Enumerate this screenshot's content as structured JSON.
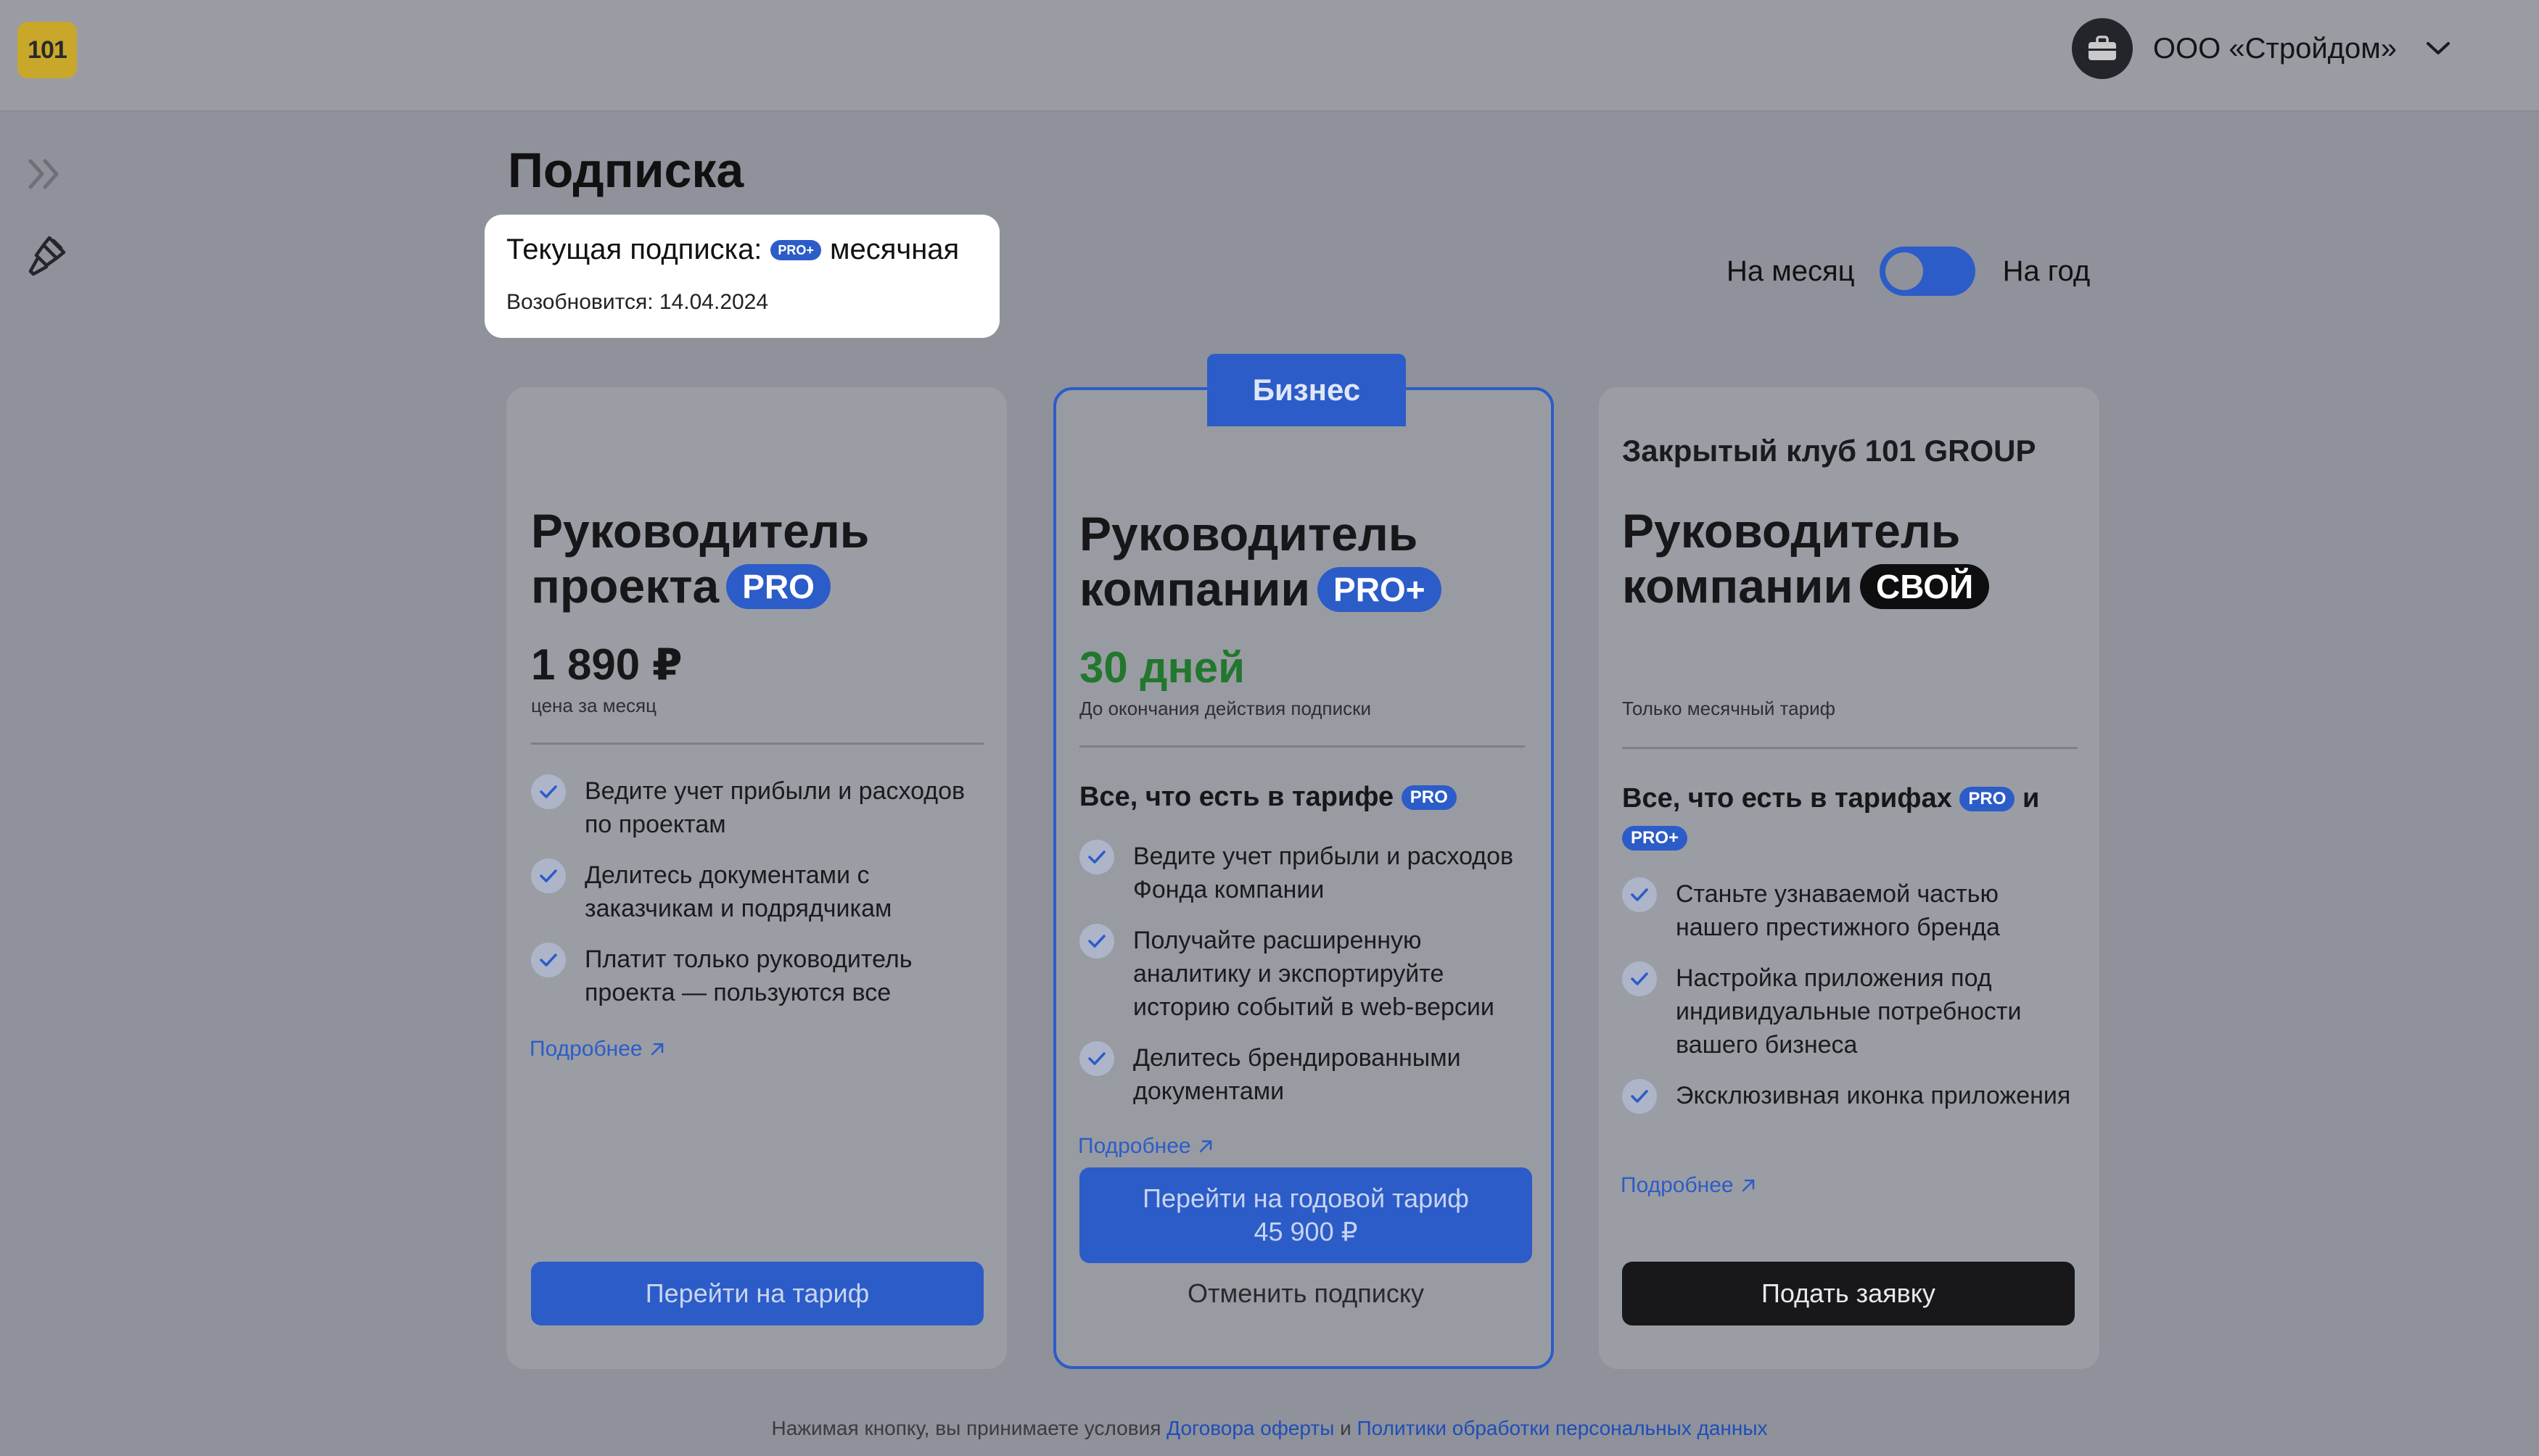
{
  "header": {
    "logo_text": "101",
    "company_name": "ООО «Стройдом»"
  },
  "page": {
    "title": "Подписка"
  },
  "current_subscription": {
    "label": "Текущая подписка:",
    "badge": "PRO+",
    "period": "месячная",
    "renews": "Возобновится: 14.04.2024"
  },
  "period_toggle": {
    "month_label": "На месяц",
    "year_label": "На год",
    "selected": "На месяц"
  },
  "plans": [
    {
      "title_line1": "Руководитель",
      "title_line2": "проекта",
      "badge": "PRO",
      "price": "1 890 ₽",
      "price_caption": "цена за месяц",
      "features": [
        "Ведите учет прибыли и расходов по проектам",
        "Делитесь документами с заказчикам и подрядчикам",
        "Платит только руководитель проекта — пользуются все"
      ],
      "more_link": "Подробнее",
      "button": "Перейти на тариф"
    },
    {
      "tab": "Бизнес",
      "title_line1": "Руководитель",
      "title_line2": "компании",
      "badge": "PRO+",
      "price": "30 дней",
      "price_caption": "До окончания действия подписки",
      "includes_text": "Все, что есть в тарифе",
      "includes_badge": "PRO",
      "features": [
        "Ведите учет прибыли и расходов Фонда компании",
        "Получайте расширенную аналитику и экспортируйте историю событий в web-версии",
        "Делитесь брендированными документами"
      ],
      "more_link": "Подробнее",
      "button_line1": "Перейти на годовой тариф",
      "button_line2": "45 900 ₽",
      "cancel": "Отменить подписку"
    },
    {
      "kicker": "Закрытый клуб 101 GROUP",
      "title_line1": "Руководитель",
      "title_line2": "компании",
      "badge": "СВОЙ",
      "price_caption": "Только месячный тариф",
      "includes_text": "Все, что есть в тарифах",
      "includes_badge1": "PRO",
      "includes_and": "и",
      "includes_badge2": "PRO+",
      "features": [
        "Станьте узнаваемой частью нашего престижного бренда",
        "Настройка приложения под индивидуальные потребности вашего бизнеса",
        "Эксклюзивная иконка приложения"
      ],
      "more_link": "Подробнее",
      "button": "Подать заявку"
    }
  ],
  "footer": {
    "text": "Нажимая кнопку, вы принимаете условия",
    "link1": "Договора оферты",
    "and": "и",
    "link2": "Политики обработки персональных данных"
  },
  "colors": {
    "accent": "#2c5cc8",
    "success": "#22772e",
    "dark": "#18181b"
  },
  "icons": [
    "briefcase-icon",
    "chevron-down-icon",
    "expand-sidebar-icon",
    "brush-icon",
    "check-icon",
    "arrow-up-right-icon"
  ]
}
